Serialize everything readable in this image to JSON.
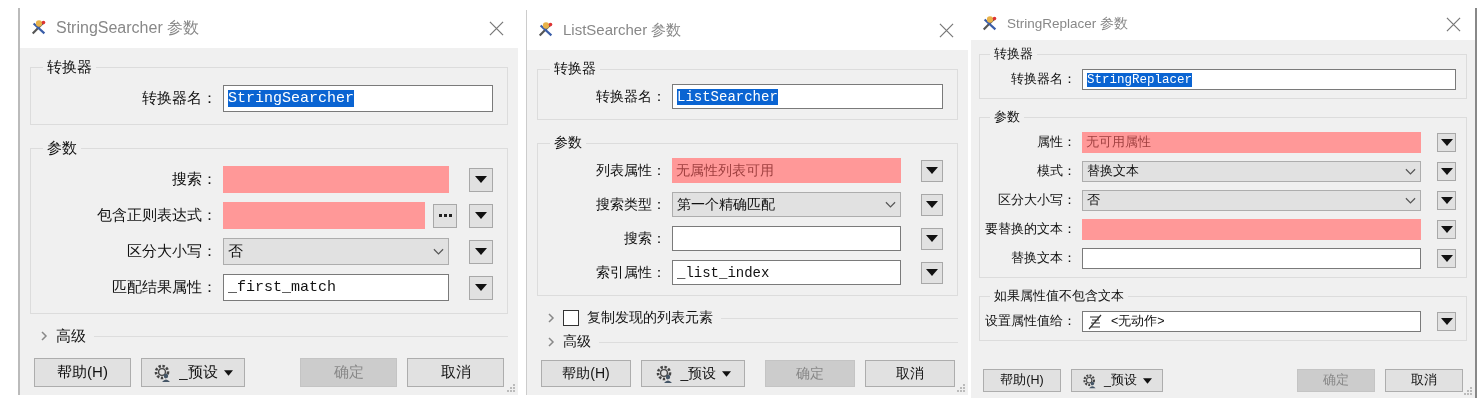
{
  "dialogs": [
    {
      "title": "StringSearcher 参数",
      "groups": [
        {
          "title": "转换器",
          "rows": [
            {
              "kind": "name",
              "label": "转换器名：",
              "value": "StringSearcher",
              "selected": true
            }
          ]
        },
        {
          "title": "参数",
          "rows": [
            {
              "kind": "required",
              "label": "搜索："
            },
            {
              "kind": "required",
              "label": "包含正则表达式：",
              "browse": true
            },
            {
              "kind": "choice",
              "label": "区分大小写：",
              "value": "否"
            },
            {
              "kind": "text",
              "label": "匹配结果属性：",
              "value": "_first_match"
            }
          ]
        }
      ],
      "sections": [
        {
          "kind": "plain",
          "label": "高级",
          "expanded": false
        }
      ],
      "buttons_left": [
        {
          "kind": "plain",
          "label": "帮助(H)",
          "disabled": false
        },
        {
          "kind": "menu",
          "label": "_预设",
          "disabled": false
        }
      ],
      "buttons_right": [
        {
          "label": "确定",
          "disabled": true
        },
        {
          "label": "取消",
          "disabled": false
        }
      ]
    },
    {
      "title": "ListSearcher 参数",
      "groups": [
        {
          "title": "转换器",
          "rows": [
            {
              "kind": "name",
              "label": "转换器名：",
              "value": "ListSearcher",
              "selected": true
            }
          ]
        },
        {
          "title": "参数",
          "rows": [
            {
              "kind": "required",
              "label": "列表属性：",
              "value": "无属性列表可用"
            },
            {
              "kind": "choice",
              "label": "搜索类型：",
              "value": "第一个精确匹配"
            },
            {
              "kind": "text",
              "label": "搜索："
            },
            {
              "kind": "text",
              "label": "索引属性：",
              "value": "_list_index"
            }
          ]
        }
      ],
      "sections": [
        {
          "kind": "checkbox",
          "label": "复制发现的列表元素",
          "expanded": false,
          "checked": false
        },
        {
          "kind": "plain",
          "label": "高级",
          "expanded": false
        }
      ],
      "buttons_left": [
        {
          "kind": "plain",
          "label": "帮助(H)",
          "disabled": false
        },
        {
          "kind": "menu",
          "label": "_预设",
          "disabled": false
        }
      ],
      "buttons_right": [
        {
          "label": "确定",
          "disabled": true
        },
        {
          "label": "取消",
          "disabled": false
        }
      ]
    },
    {
      "title": "StringReplacer 参数",
      "groups": [
        {
          "title": "转换器",
          "rows": [
            {
              "kind": "name",
              "label": "转换器名：",
              "value": "StringReplacer",
              "selected": true
            }
          ]
        },
        {
          "title": "参数",
          "rows": [
            {
              "kind": "required",
              "label": "属性：",
              "value": "无可用属性"
            },
            {
              "kind": "choice",
              "label": "模式：",
              "value": "替换文本"
            },
            {
              "kind": "choice",
              "label": "区分大小写：",
              "value": "否"
            },
            {
              "kind": "required",
              "label": "要替换的文本："
            },
            {
              "kind": "text",
              "label": "替换文本："
            }
          ]
        },
        {
          "title": "如果属性值不包含文本",
          "rows": [
            {
              "kind": "action",
              "label": "设置属性值给：",
              "value": "<无动作>"
            }
          ]
        }
      ],
      "buttons_left": [
        {
          "kind": "plain",
          "label": "帮助(H)",
          "disabled": false
        },
        {
          "kind": "menu",
          "label": "_预设",
          "disabled": false
        }
      ],
      "buttons_right": [
        {
          "label": "确定",
          "disabled": true
        },
        {
          "label": "取消",
          "disabled": false
        }
      ]
    }
  ]
}
